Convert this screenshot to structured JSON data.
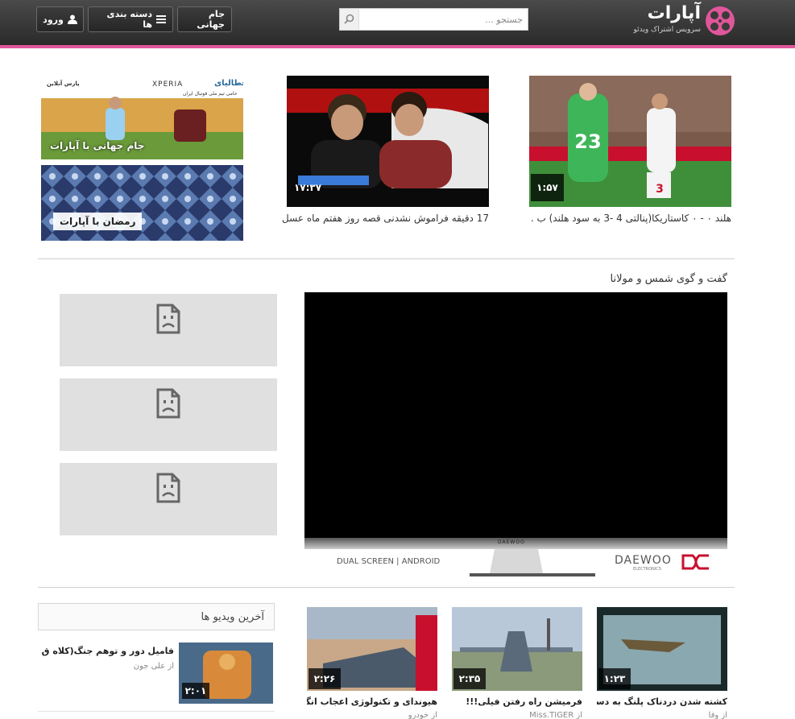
{
  "header": {
    "logo_name": "آپارات",
    "logo_tagline": "سرویس اشتراک ویدئو",
    "search_placeholder": "جستجو ...",
    "buttons": {
      "world_cup": "جام جهانی",
      "categories": "دسته بندی ها",
      "login": "ورود"
    },
    "accent_color": "#e0569a"
  },
  "featured": [
    {
      "title": "هلند ۰ - ۰ کاستاریکا(پنالتی 4 -3 به سود هلند) ب .",
      "duration": "۱:۵۷"
    },
    {
      "title": "17 دقیقه فراموش نشدنی قصه روز هفتم ماه عسل",
      "duration": "۱۷:۳۷"
    }
  ],
  "promos": [
    {
      "label": "جام جهانی با آپارات",
      "brands": [
        "عطالیای",
        "XPERIA",
        "پارس آنلاین"
      ],
      "sub": "حامی تیم ملی فوتبال ایران"
    },
    {
      "label": "رمضان با آپارات"
    }
  ],
  "player_section": {
    "title": "گفت و گوی شمس و مولانا",
    "brand_left": "DUAL SCREEN | ANDROID",
    "brand_right": "DAEWOO",
    "brand_right_sub": "ELECTRONICS",
    "bezel_brand": "DAEWOO"
  },
  "latest": {
    "title": "آخرین ویدیو ها",
    "items": [
      {
        "title": "فامیل دور و توهم جنگ(کلاه ق ..",
        "author": "از علی جون",
        "duration": "۲:۰۱"
      }
    ]
  },
  "bottom_videos": [
    {
      "title": "هیوندای و تکنولوژی اعجاب انگیز..",
      "author": "از خودرو",
      "duration": "۲:۲۶"
    },
    {
      "title": "فرمیشن راه رفتن فیلی!!!",
      "author": "از Miss.TIGER",
      "duration": "۲:۳۵"
    },
    {
      "title": "کشته شدن دردناک پلنگ به دست..",
      "author": "از وفا",
      "duration": "۱:۲۳"
    }
  ]
}
